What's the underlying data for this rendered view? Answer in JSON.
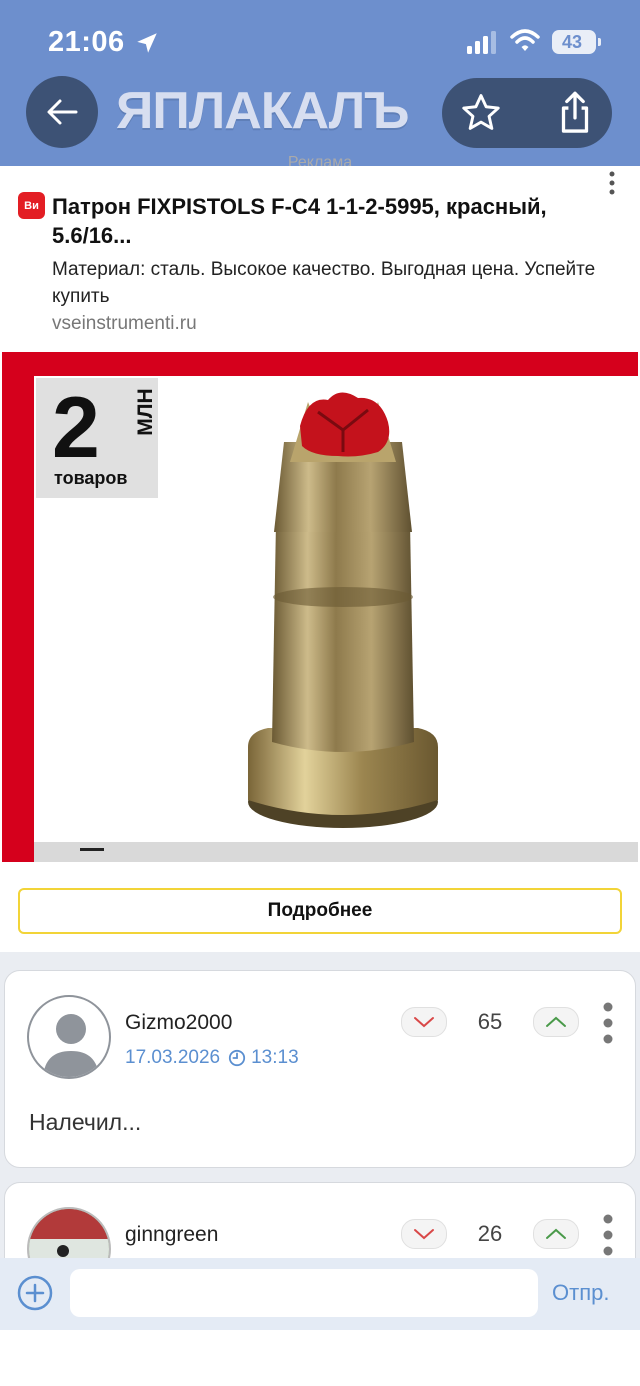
{
  "status_bar": {
    "time": "21:06",
    "battery": "43"
  },
  "header": {
    "logo_text": "ЯПЛАКАЛЪ",
    "back_icon": "arrow-left-icon",
    "favorite_icon": "star-icon",
    "share_icon": "share-icon"
  },
  "ad": {
    "label": "Реклама",
    "badge": "Ви",
    "title": "Патрон FIXPISTOLS F-C4 1-1-2-5995, красный, 5.6/16...",
    "description": "Материал: сталь. Высокое качество. Выгодная цена. Успейте купить",
    "domain": "vseinstrumenti.ru",
    "promo_number": "2",
    "promo_unit": "МЛН",
    "promo_sub": "товаров",
    "more_button": "Подробнее"
  },
  "comments": [
    {
      "author": "Gizmo2000",
      "date": "17.03.2026",
      "time": "13:13",
      "rating": "65",
      "text": "Налечил..."
    },
    {
      "author": "ginngreen",
      "rating": "26"
    }
  ],
  "reply": {
    "placeholder": "",
    "send_label": "Отпр."
  },
  "colors": {
    "header": "#6d8fcd",
    "header_button": "#3d5275",
    "ad_red": "#d5001c",
    "more_border": "#f2d438",
    "link_blue": "#5b8fd0"
  }
}
